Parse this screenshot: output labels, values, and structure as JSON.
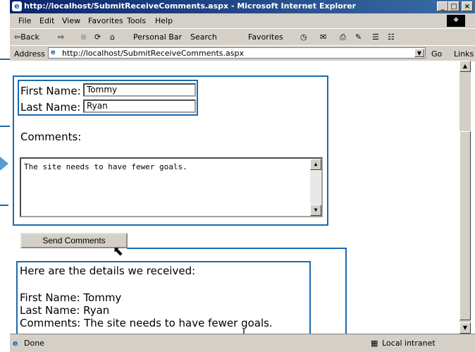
{
  "window": {
    "title": "http://localhost/SubmitReceiveComments.aspx - Microsoft Internet Explorer",
    "minimize": "_",
    "maximize": "□",
    "close": "×"
  },
  "menu": [
    "File",
    "Edit",
    "View",
    "Favorites",
    "Tools",
    "Help"
  ],
  "toolbar": {
    "back": "⇦Back",
    "forward": "⇨",
    "personal_bar": "Personal Bar",
    "search": "Search",
    "favorites": "Favorites"
  },
  "address": {
    "label": "Address",
    "url": "http://localhost/SubmitReceiveComments.aspx",
    "go": "Go",
    "links": "Links »"
  },
  "form": {
    "first_name_label": "First Name:",
    "first_name_value": "Tommy",
    "last_name_label": "Last Name:",
    "last_name_value": "Ryan",
    "comments_label": "Comments:",
    "comments_value": "The site needs to have fewer goals.",
    "send_button": "Send Comments"
  },
  "result": {
    "heading": "Here are the details we received:",
    "first_name": "First Name: Tommy",
    "last_name": "Last Name: Ryan",
    "comments": "Comments: The site needs to have fewer goals."
  },
  "status": {
    "text": "Done",
    "zone": "Local intranet"
  },
  "colors": {
    "annotation_blue": "#1a6ab0",
    "titlebar": "#0a246a"
  }
}
